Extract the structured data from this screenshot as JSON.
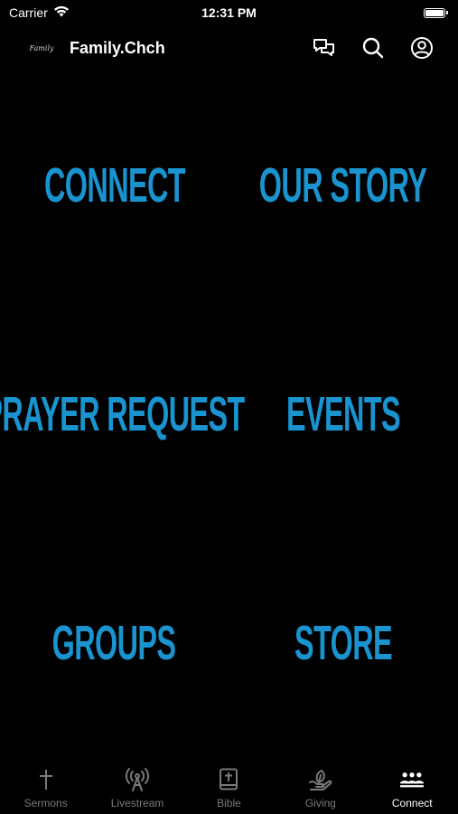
{
  "status_bar": {
    "carrier": "Carrier",
    "time": "12:31 PM",
    "battery_level": 1.0
  },
  "header": {
    "logo_text": "Family",
    "title": "Family.Chch",
    "icons": [
      "chat-icon",
      "search-icon",
      "profile-icon"
    ]
  },
  "tiles": [
    {
      "label": "CONNECT"
    },
    {
      "label": "OUR STORY"
    },
    {
      "label": "PRAYER REQUEST"
    },
    {
      "label": "EVENTS"
    },
    {
      "label": "GROUPS"
    },
    {
      "label": "STORE"
    }
  ],
  "colors": {
    "accent": "#1a93cf",
    "background": "#000000",
    "tab_inactive": "#7a7a7a",
    "tab_active": "#ffffff"
  },
  "tabbar": {
    "items": [
      {
        "label": "Sermons",
        "icon": "cross-icon"
      },
      {
        "label": "Livestream",
        "icon": "broadcast-icon"
      },
      {
        "label": "Bible",
        "icon": "bible-icon"
      },
      {
        "label": "Giving",
        "icon": "leaf-hand-icon"
      },
      {
        "label": "Connect",
        "icon": "people-icon"
      }
    ],
    "active": "Connect"
  }
}
